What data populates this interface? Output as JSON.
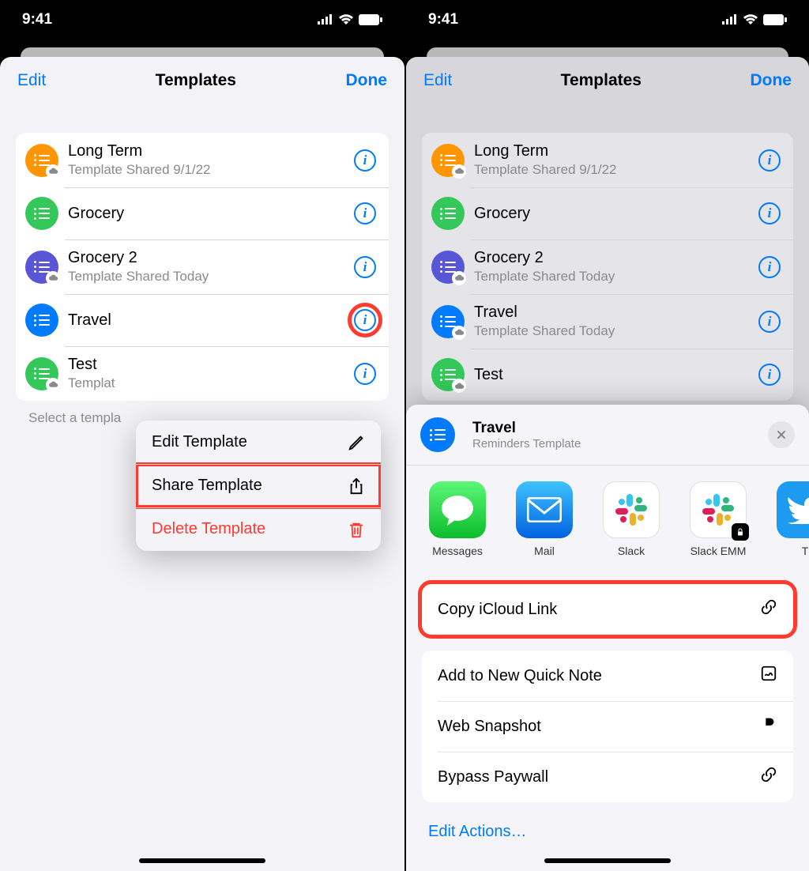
{
  "status": {
    "time": "9:41"
  },
  "nav": {
    "edit": "Edit",
    "title": "Templates",
    "done": "Done"
  },
  "templates_left": [
    {
      "title": "Long Term",
      "sub": "Template Shared 9/1/22",
      "color": "bg-orange",
      "cloud": true
    },
    {
      "title": "Grocery",
      "sub": "",
      "color": "bg-green",
      "cloud": false
    },
    {
      "title": "Grocery 2",
      "sub": "Template Shared Today",
      "color": "bg-purple",
      "cloud": true
    },
    {
      "title": "Travel",
      "sub": "",
      "color": "bg-blue",
      "cloud": false
    },
    {
      "title": "Test",
      "sub": "Templat",
      "color": "bg-green",
      "cloud": true
    }
  ],
  "templates_right": [
    {
      "title": "Long Term",
      "sub": "Template Shared 9/1/22",
      "color": "bg-orange",
      "cloud": true
    },
    {
      "title": "Grocery",
      "sub": "",
      "color": "bg-green",
      "cloud": false
    },
    {
      "title": "Grocery 2",
      "sub": "Template Shared Today",
      "color": "bg-purple",
      "cloud": true
    },
    {
      "title": "Travel",
      "sub": "Template Shared Today",
      "color": "bg-blue",
      "cloud": true
    },
    {
      "title": "Test",
      "sub": "",
      "color": "bg-green",
      "cloud": true
    }
  ],
  "footer_hint": "Select a templa",
  "context_menu": {
    "edit": "Edit Template",
    "share": "Share Template",
    "delete": "Delete Template"
  },
  "share_sheet": {
    "title": "Travel",
    "subtitle": "Reminders Template",
    "apps": [
      {
        "label": "Messages",
        "kind": "messages"
      },
      {
        "label": "Mail",
        "kind": "mail"
      },
      {
        "label": "Slack",
        "kind": "slack"
      },
      {
        "label": "Slack EMM",
        "kind": "slack-emm"
      },
      {
        "label": "T",
        "kind": "twitter"
      }
    ],
    "actions_primary": [
      {
        "label": "Copy iCloud Link",
        "icon": "link"
      }
    ],
    "actions_secondary": [
      {
        "label": "Add to New Quick Note",
        "icon": "note"
      },
      {
        "label": "Web Snapshot",
        "icon": "p"
      },
      {
        "label": "Bypass Paywall",
        "icon": "link"
      }
    ],
    "edit_actions": "Edit Actions…"
  }
}
